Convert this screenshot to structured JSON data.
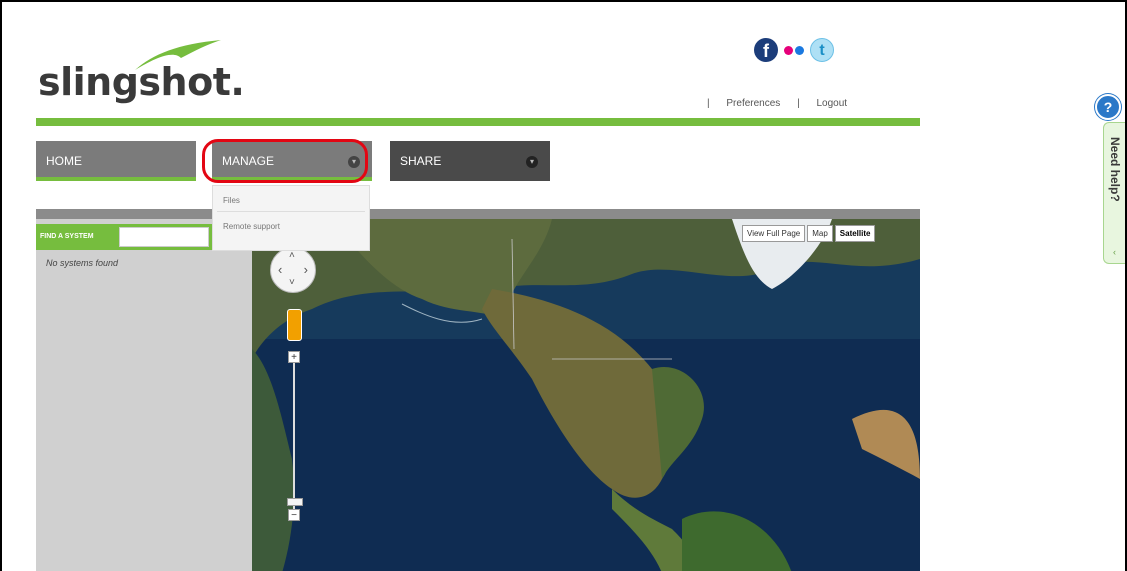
{
  "brand": {
    "name": "slingshot."
  },
  "social": {
    "facebook": "f",
    "twitter": "t"
  },
  "top_links": {
    "separator": "|",
    "preferences": "Preferences",
    "logout": "Logout"
  },
  "nav": {
    "home": "HOME",
    "manage": "MANAGE",
    "share": "SHARE",
    "dropdown": [
      "Files",
      "Remote support"
    ]
  },
  "sidebar": {
    "find_label": "FIND A SYSTEM",
    "find_value": "",
    "empty_message": "No systems found"
  },
  "map": {
    "buttons": {
      "full_page": "View Full Page",
      "map": "Map",
      "satellite": "Satellite"
    },
    "zoom_in": "+",
    "zoom_out": "−"
  },
  "help": {
    "label": "Need help?",
    "icon": "?"
  },
  "colors": {
    "accent_green": "#76bd3e",
    "highlight_red": "#e30613",
    "tab_gray": "#7b7b7b",
    "tab_dark": "#4a4a4a"
  }
}
